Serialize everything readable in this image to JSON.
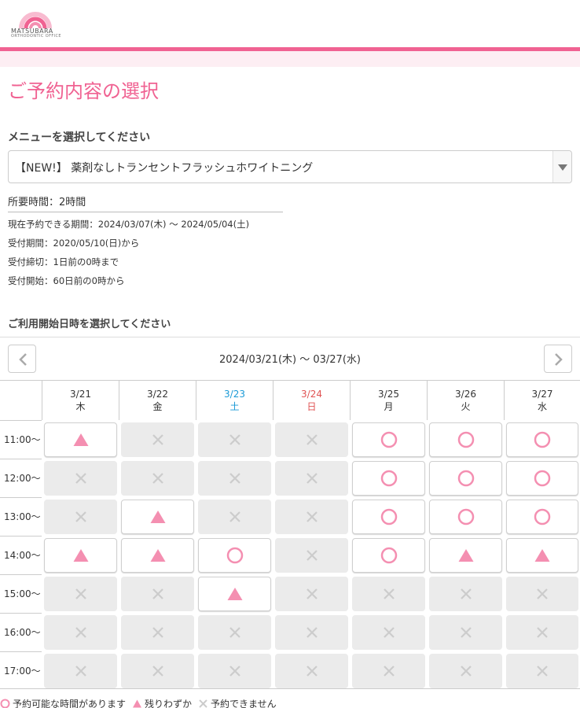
{
  "colors": {
    "accent": "#f06292",
    "available": "#f48fb1",
    "unavailable": "#cccccc",
    "saturday": "#1a9ad6",
    "sunday": "#e05252"
  },
  "header": {
    "logo_name": "MATSUBARA",
    "logo_sub": "ORTHODONTIC OFFICE"
  },
  "page_title": "ご予約内容の選択",
  "menu": {
    "label": "メニューを選択してください",
    "selected": "【NEW!】 薬剤なしトランセントフラッシュホワイトニング"
  },
  "duration": "所要時間：2時間",
  "info": [
    "現在予約できる期間：2024/03/07(木) 〜 2024/05/04(土)",
    "受付期間：2020/05/10(日)から",
    "受付締切：1日前の0時まで",
    "受付開始：60日前の0時から"
  ],
  "date_select_label": "ご利用開始日時を選択してください",
  "week_range": "2024/03/21(木) 〜 03/27(水)",
  "days": [
    {
      "date": "3/21",
      "weekday": "木",
      "type": "weekday"
    },
    {
      "date": "3/22",
      "weekday": "金",
      "type": "weekday"
    },
    {
      "date": "3/23",
      "weekday": "土",
      "type": "sat"
    },
    {
      "date": "3/24",
      "weekday": "日",
      "type": "sun"
    },
    {
      "date": "3/25",
      "weekday": "月",
      "type": "weekday"
    },
    {
      "date": "3/26",
      "weekday": "火",
      "type": "weekday"
    },
    {
      "date": "3/27",
      "weekday": "水",
      "type": "weekday"
    }
  ],
  "times": [
    "11:00〜",
    "12:00〜",
    "13:00〜",
    "14:00〜",
    "15:00〜",
    "16:00〜",
    "17:00〜"
  ],
  "slots": [
    [
      "few",
      "none",
      "none",
      "none",
      "open",
      "open",
      "open"
    ],
    [
      "none",
      "none",
      "none",
      "none",
      "open",
      "open",
      "open"
    ],
    [
      "none",
      "few",
      "none",
      "none",
      "open",
      "open",
      "open"
    ],
    [
      "few",
      "few",
      "open",
      "none",
      "open",
      "few",
      "few"
    ],
    [
      "none",
      "none",
      "few",
      "none",
      "none",
      "none",
      "none"
    ],
    [
      "none",
      "none",
      "none",
      "none",
      "none",
      "none",
      "none"
    ],
    [
      "none",
      "none",
      "none",
      "none",
      "none",
      "none",
      "none"
    ]
  ],
  "legend": {
    "open": "予約可能な時間があります",
    "few": "残りわずか",
    "none": "予約できません"
  }
}
